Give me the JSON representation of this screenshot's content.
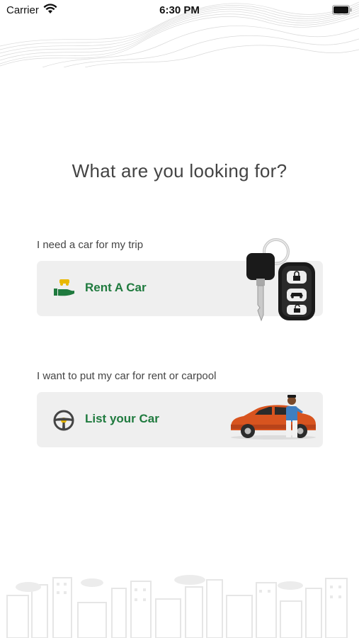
{
  "status_bar": {
    "carrier": "Carrier",
    "time": "6:30 PM"
  },
  "page": {
    "question": "What are you looking for?"
  },
  "options": [
    {
      "caption": "I need a car for my trip",
      "label": "Rent A Car",
      "icon": "hand-car-icon",
      "illustration": "car-keys-illustration"
    },
    {
      "caption": "I want to put my car for rent or carpool",
      "label": "List your Car",
      "icon": "steering-wheel-icon",
      "illustration": "driver-with-car-illustration"
    }
  ],
  "colors": {
    "accent_green": "#1f7a3e",
    "card_background": "#efefef",
    "car_orange": "#d8541f"
  }
}
